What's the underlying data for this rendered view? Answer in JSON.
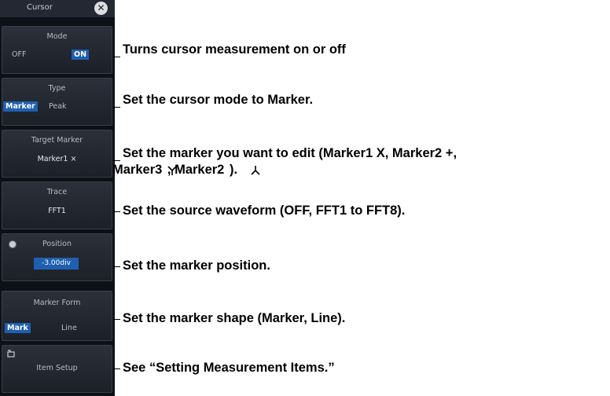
{
  "panel": {
    "title": "Cursor",
    "close_glyph": "✕",
    "mode": {
      "label": "Mode",
      "options": [
        "OFF",
        "ON"
      ],
      "selected": "ON"
    },
    "type": {
      "label": "Type",
      "options": [
        "Marker",
        "Peak"
      ],
      "selected": "Marker"
    },
    "target_marker": {
      "label": "Target Marker",
      "value": "Marker1 ×"
    },
    "trace": {
      "label": "Trace",
      "value": "FFT1"
    },
    "position": {
      "label": "Position",
      "value": "-3.00div"
    },
    "marker_form": {
      "label": "Marker Form",
      "options": [
        "Mark",
        "Line"
      ],
      "selected": "Mark"
    },
    "item_setup": {
      "label": "Item Setup",
      "icon": "item-setup-icon"
    }
  },
  "callouts": [
    "Turns cursor measurement on or off",
    "Set the cursor mode to Marker.",
    "Set the marker you want to edit (Marker1 X, Marker2 +,",
    "Marker3  , Marker2  ).",
    "Set the source waveform (OFF, FFT1 to FFT8).",
    "Set the marker position.",
    "Set the marker shape (Marker, Line).",
    "See “Setting Measurement Items.”"
  ],
  "colors": {
    "panel_bg": "#0d1016",
    "item_bg": "#2b303a",
    "selected": "#1f5fb0",
    "text": "#c9ccd2"
  }
}
